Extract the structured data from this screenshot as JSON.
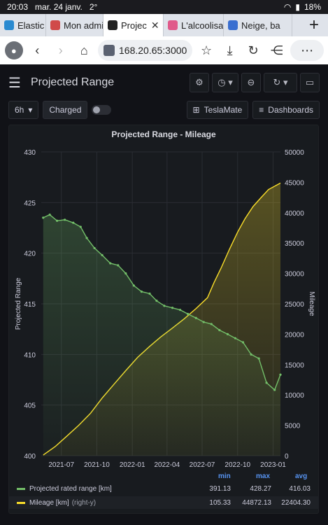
{
  "status_bar": {
    "time": "20:03",
    "date": "mar. 24 janv.",
    "temp": "2°",
    "battery": "18%"
  },
  "browser": {
    "tabs": [
      {
        "label": "Elastic",
        "color": "#2a8ad0",
        "active": false
      },
      {
        "label": "Mon admi",
        "color": "#d04a4a",
        "active": false
      },
      {
        "label": "Projec",
        "color": "#222222",
        "active": true
      },
      {
        "label": "L'alcoolisa",
        "color": "#e05a8a",
        "active": false
      },
      {
        "label": "Neige, ba",
        "color": "#3a6fd0",
        "active": false
      }
    ],
    "new_tab": "+",
    "url": "168.20.65:3000"
  },
  "grafana": {
    "page_title": "Projected Range",
    "time_range": "6h",
    "charged_label": "Charged",
    "teslamate_label": "TeslaMate",
    "dashboards_label": "Dashboards"
  },
  "chart_data": {
    "type": "line",
    "title": "Projected Range - Mileage",
    "ylabel": "Projected Range",
    "y2label": "Mileage",
    "ylim": [
      400,
      430
    ],
    "y2lim": [
      0,
      50000
    ],
    "x_ticks": [
      "2021-07",
      "2021-10",
      "2022-01",
      "2022-04",
      "2022-07",
      "2022-10",
      "2023-01"
    ],
    "y_ticks": [
      "400",
      "405",
      "410",
      "415",
      "420",
      "425",
      "430"
    ],
    "y2_ticks": [
      "0",
      "5000",
      "10000",
      "15000",
      "20000",
      "25000",
      "30000",
      "35000",
      "40000",
      "45000",
      "50000"
    ],
    "x_range": [
      "2021-05-10",
      "2023-01-20"
    ],
    "grid": true,
    "series": [
      {
        "name": "Projected rated range [km]",
        "color": "#73bf69",
        "axis": "left",
        "points": [
          [
            "2021-05-15",
            423.5
          ],
          [
            "2021-06-01",
            423.8
          ],
          [
            "2021-06-20",
            423.2
          ],
          [
            "2021-07-10",
            423.3
          ],
          [
            "2021-08-01",
            423.0
          ],
          [
            "2021-08-20",
            422.6
          ],
          [
            "2021-09-05",
            421.5
          ],
          [
            "2021-09-25",
            420.5
          ],
          [
            "2021-10-15",
            419.8
          ],
          [
            "2021-11-05",
            419.0
          ],
          [
            "2021-11-25",
            418.8
          ],
          [
            "2021-12-15",
            418.0
          ],
          [
            "2022-01-05",
            416.8
          ],
          [
            "2022-01-25",
            416.2
          ],
          [
            "2022-02-15",
            416.0
          ],
          [
            "2022-03-05",
            415.3
          ],
          [
            "2022-03-25",
            414.8
          ],
          [
            "2022-04-15",
            414.6
          ],
          [
            "2022-05-05",
            414.4
          ],
          [
            "2022-05-25",
            414.0
          ],
          [
            "2022-06-15",
            413.6
          ],
          [
            "2022-07-05",
            413.2
          ],
          [
            "2022-07-25",
            413.0
          ],
          [
            "2022-08-15",
            412.4
          ],
          [
            "2022-09-05",
            412.0
          ],
          [
            "2022-09-25",
            411.6
          ],
          [
            "2022-10-15",
            411.2
          ],
          [
            "2022-11-05",
            410.0
          ],
          [
            "2022-11-25",
            409.6
          ],
          [
            "2022-12-15",
            407.2
          ],
          [
            "2023-01-05",
            406.5
          ],
          [
            "2023-01-20",
            408.0
          ]
        ]
      },
      {
        "name": "Mileage [km]",
        "axis_note": "(right-y)",
        "color": "#fade2a",
        "axis": "right",
        "points": [
          [
            "2021-05-15",
            105
          ],
          [
            "2021-06-15",
            1500
          ],
          [
            "2021-07-15",
            3200
          ],
          [
            "2021-08-15",
            5000
          ],
          [
            "2021-09-15",
            7000
          ],
          [
            "2021-10-15",
            9500
          ],
          [
            "2021-11-15",
            11800
          ],
          [
            "2021-12-15",
            14000
          ],
          [
            "2022-01-15",
            16200
          ],
          [
            "2022-02-15",
            18000
          ],
          [
            "2022-03-15",
            19500
          ],
          [
            "2022-04-15",
            21000
          ],
          [
            "2022-05-15",
            22500
          ],
          [
            "2022-06-15",
            24200
          ],
          [
            "2022-07-15",
            26000
          ],
          [
            "2022-08-01",
            28500
          ],
          [
            "2022-08-20",
            31000
          ],
          [
            "2022-09-10",
            34000
          ],
          [
            "2022-10-01",
            36800
          ],
          [
            "2022-10-20",
            39000
          ],
          [
            "2022-11-10",
            41000
          ],
          [
            "2022-12-01",
            42500
          ],
          [
            "2022-12-20",
            43800
          ],
          [
            "2023-01-20",
            44872
          ]
        ]
      }
    ],
    "legend": {
      "headers": [
        "min",
        "max",
        "avg"
      ],
      "rows": [
        {
          "name": "Projected rated range [km]",
          "suffix": "",
          "color": "#73bf69",
          "min": "391.13",
          "max": "428.27",
          "avg": "416.03"
        },
        {
          "name": "Mileage [km]",
          "suffix": "(right-y)",
          "color": "#fade2a",
          "min": "105.33",
          "max": "44872.13",
          "avg": "22404.30"
        }
      ]
    }
  }
}
